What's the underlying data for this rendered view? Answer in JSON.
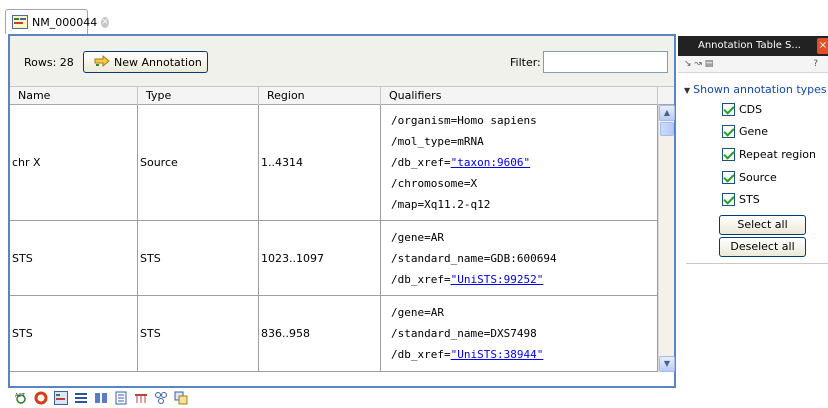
{
  "editor_tab": {
    "title": "NM_000044"
  },
  "toolbar": {
    "rows_label": "Rows: 28",
    "new_annotation_label": "New Annotation",
    "filter_label": "Filter:",
    "filter_value": ""
  },
  "table": {
    "columns": [
      "Name",
      "Type",
      "Region",
      "Qualifiers"
    ],
    "rows": [
      {
        "name": "chr X",
        "type": "Source",
        "region": "1..4314",
        "qualifiers": [
          {
            "text": "/organism=Homo sapiens",
            "link": ""
          },
          {
            "text": "/mol_type=mRNA",
            "link": ""
          },
          {
            "text": "/db_xref=",
            "link": "\"taxon:9606\""
          },
          {
            "text": "/chromosome=X",
            "link": ""
          },
          {
            "text": "/map=Xq11.2-q12",
            "link": ""
          }
        ]
      },
      {
        "name": "STS",
        "type": "STS",
        "region": "1023..1097",
        "qualifiers": [
          {
            "text": "/gene=AR",
            "link": ""
          },
          {
            "text": "/standard_name=GDB:600694",
            "link": ""
          },
          {
            "text": "/db_xref=",
            "link": "\"UniSTS:99252\""
          }
        ]
      },
      {
        "name": "STS",
        "type": "STS",
        "region": "836..958",
        "qualifiers": [
          {
            "text": "/gene=AR",
            "link": ""
          },
          {
            "text": "/standard_name=DXS7498",
            "link": ""
          },
          {
            "text": "/db_xref=",
            "link": "\"UniSTS:38944\""
          }
        ]
      }
    ]
  },
  "side_panel": {
    "title": "Annotation Table S...",
    "help_label": "?",
    "section_title": "Shown annotation types",
    "types": [
      {
        "label": "CDS",
        "checked": true
      },
      {
        "label": "Gene",
        "checked": true
      },
      {
        "label": "Repeat region",
        "checked": true
      },
      {
        "label": "Source",
        "checked": true
      },
      {
        "label": "STS",
        "checked": true
      }
    ],
    "select_all_label": "Select all",
    "deselect_all_label": "Deselect all"
  },
  "icons": {
    "tab": "sequence-document-icon",
    "tab_close": "close-circle-icon",
    "new_annotation": "arrow-add-icon",
    "view_bar": [
      "circular-view-icon",
      "record-icon",
      "sequence-view-icon",
      "list-view-icon",
      "text-view-icon",
      "table-view-icon",
      "annotation-table-icon",
      "tree-icon",
      "graph-icon"
    ]
  },
  "colors": {
    "frame_border": "#5b84c4",
    "link": "#0000ee",
    "side_title": "#1047b0",
    "side_header_bg": "#222222"
  }
}
